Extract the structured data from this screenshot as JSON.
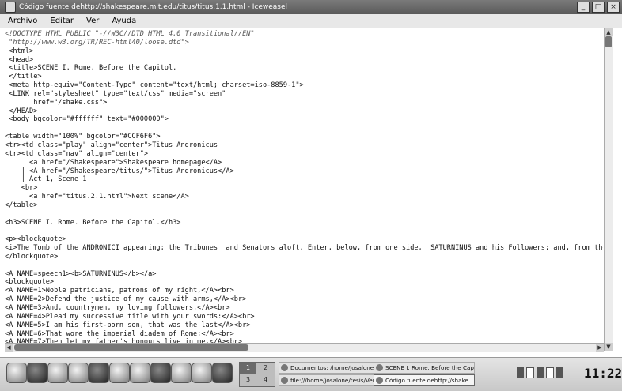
{
  "window": {
    "title": "Código fuente dehttp://shakespeare.mit.edu/titus/titus.1.1.html - Iceweasel",
    "controls": [
      "_",
      "□",
      "×"
    ]
  },
  "menubar": {
    "items": [
      "Archivo",
      "Editar",
      "Ver",
      "Ayuda"
    ]
  },
  "source_lines": [
    "<!DOCTYPE HTML PUBLIC \"-//W3C//DTD HTML 4.0 Transitional//EN\"",
    " \"http://www.w3.org/TR/REC-html40/loose.dtd\">",
    " <html>",
    " <head>",
    " <title>SCENE I. Rome. Before the Capitol.",
    " </title>",
    " <meta http-equiv=\"Content-Type\" content=\"text/html; charset=iso-8859-1\">",
    " <LINK rel=\"stylesheet\" type=\"text/css\" media=\"screen\"",
    "       href=\"/shake.css\">",
    " </HEAD>",
    " <body bgcolor=\"#ffffff\" text=\"#000000\">",
    "",
    "<table width=\"100%\" bgcolor=\"#CCF6F6\">",
    "<tr><td class=\"play\" align=\"center\">Titus Andronicus",
    "<tr><td class=\"nav\" align=\"center\">",
    "      <a href=\"/Shakespeare\">Shakespeare homepage</A>",
    "    | <A href=\"/Shakespeare/titus/\">Titus Andronicus</A>",
    "    | Act 1, Scene 1",
    "    <br>",
    "      <a href=\"titus.2.1.html\">Next scene</A>",
    "</table>",
    "",
    "<h3>SCENE I. Rome. Before the Capitol.</h3>",
    "",
    "<p><blockquote>",
    "<i>The Tomb of the ANDRONICI appearing; the Tribunes  and Senators aloft. Enter, below, from one side,  SATURNINUS and his Followers; and, from the other si",
    "</blockquote>",
    "",
    "<A NAME=speech1><b>SATURNINUS</b></a>",
    "<blockquote>",
    "<A NAME=1>Noble patricians, patrons of my right,</A><br>",
    "<A NAME=2>Defend the justice of my cause with arms,</A><br>",
    "<A NAME=3>And, countrymen, my loving followers,</A><br>",
    "<A NAME=4>Plead my successive title with your swords:</A><br>",
    "<A NAME=5>I am his first-born son, that was the last</A><br>",
    "<A NAME=6>That wore the imperial diadem of Rome;</A><br>",
    "<A NAME=7>Then let my father's honours live in me,</A><br>"
  ],
  "taskbar": {
    "launchers": [
      "terminal-icon",
      "home-icon",
      "network-icon",
      "settings-icon",
      "browser-icon",
      "monitor-icon",
      "package-icon",
      "media-icon",
      "chat-icon",
      "editor-icon",
      "calendar-icon"
    ],
    "workspaces": [
      "1",
      "2",
      "3",
      "4"
    ],
    "tasks": [
      {
        "label": "Documentos: /home/josalone/tesis"
      },
      {
        "label": "SCENE I. Rome. Before the Capitol"
      },
      {
        "label": "file:///home/josalone/tesis/Ver"
      },
      {
        "label": "Código fuente dehttp://shake"
      }
    ],
    "clock": "11:22"
  }
}
